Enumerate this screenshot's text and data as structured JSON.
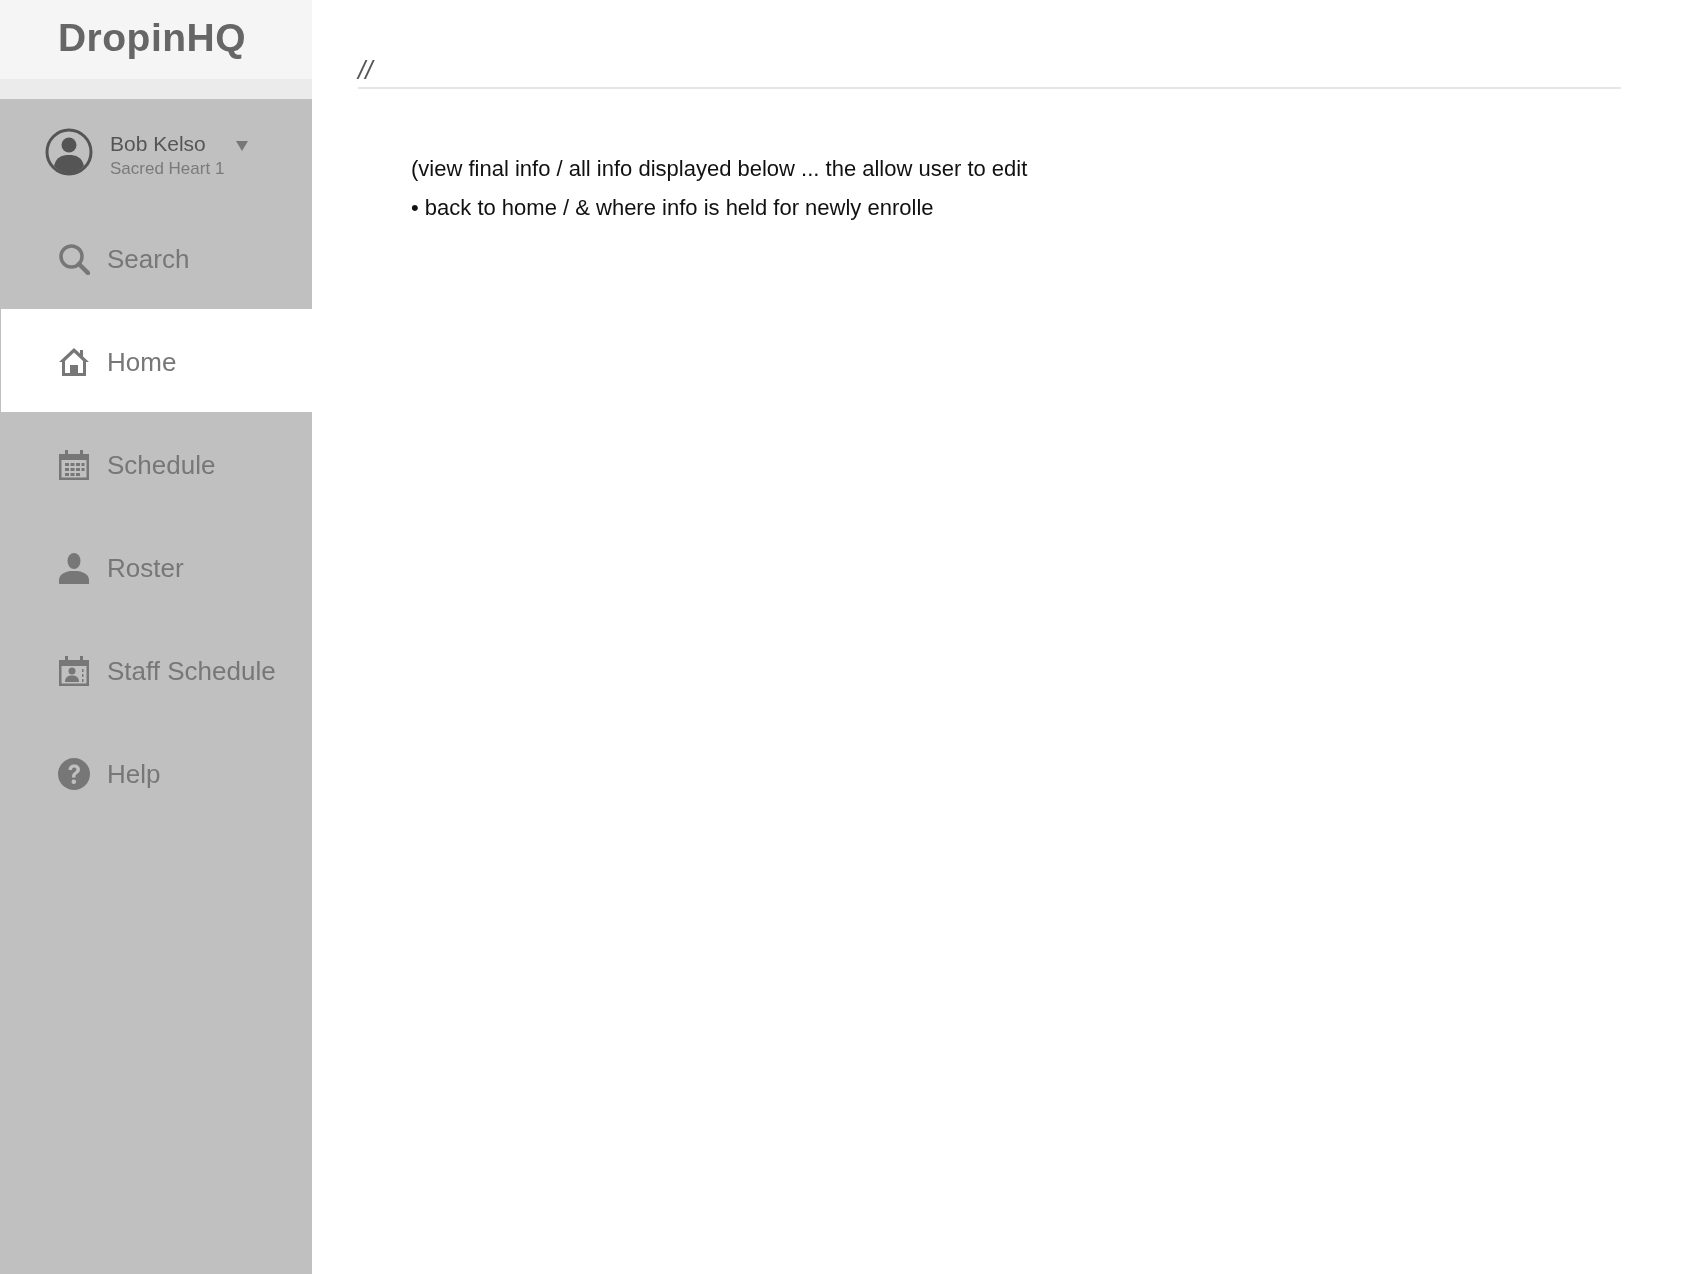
{
  "sidebar": {
    "logo": "DropinHQ",
    "user": {
      "name": "Bob Kelso",
      "location": "Sacred Heart 1"
    },
    "items": [
      {
        "label": "Search",
        "kind": "search",
        "selected": false
      },
      {
        "label": "Home",
        "kind": "home",
        "selected": true
      },
      {
        "label": "Schedule",
        "kind": "calendar",
        "selected": false
      },
      {
        "label": "Roster",
        "kind": "person",
        "selected": false
      },
      {
        "label": "Staff Schedule",
        "kind": "staff-calendar",
        "selected": false
      },
      {
        "label": "Help",
        "kind": "help",
        "selected": false
      }
    ]
  },
  "main": {
    "heading": "//",
    "notes": [
      "(view final info / all info displayed below ... the allow user to edit",
      "• back to home / & where info is held for newly enrolle"
    ]
  }
}
